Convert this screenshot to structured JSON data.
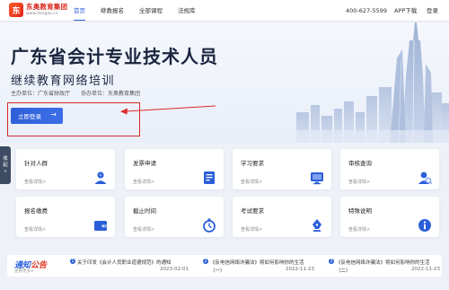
{
  "header": {
    "logo_badge": "东",
    "logo_name": "东奥教育集团",
    "logo_url_text": "www.dongao.cn",
    "nav": [
      {
        "label": "首页",
        "active": true
      },
      {
        "label": "继教报名",
        "active": false
      },
      {
        "label": "全部课程",
        "active": false
      },
      {
        "label": "法规库",
        "active": false
      }
    ],
    "hotline": "400-627-5599",
    "app_download": "APP下载",
    "login": "登录"
  },
  "hero": {
    "title": "广东省会计专业技术人员",
    "subtitle": "继续教育网络培训",
    "sponsor": "主办单位：广东省财政厅",
    "co_sponsor": "协办单位：东奥教育集团",
    "start_button": "立即登录",
    "start_arrow": "→"
  },
  "side_tab": {
    "chars": [
      "收",
      "起",
      "»"
    ]
  },
  "cards": [
    {
      "title": "针对人群",
      "link": "查看详情>",
      "icon": "user-icon"
    },
    {
      "title": "发票申请",
      "link": "查看详情>",
      "icon": "invoice-icon"
    },
    {
      "title": "学习要求",
      "link": "查看详情>",
      "icon": "monitor-icon"
    },
    {
      "title": "审核查询",
      "link": "查看详情>",
      "icon": "search-person-icon"
    },
    {
      "title": "报名缴费",
      "link": "查看详情>",
      "icon": "wallet-icon"
    },
    {
      "title": "截止时间",
      "link": "查看详情>",
      "icon": "stopwatch-icon"
    },
    {
      "title": "考试要求",
      "link": "查看详情>",
      "icon": "pen-nib-icon"
    },
    {
      "title": "特殊说明",
      "link": "查看详情>",
      "icon": "info-icon"
    }
  ],
  "notice": {
    "brand_a": "通知",
    "brand_b": "公告",
    "more": "查看更多>",
    "items": [
      {
        "badge": "1",
        "title": "关于印发《会计人员职业道德规范》的通知",
        "title2": "",
        "date": "2023-02-01"
      },
      {
        "badge": "2",
        "title": "《反电信网络诈骗法》将如何影响你的生活",
        "title2": "（一）",
        "date": "2022-11-23"
      },
      {
        "badge": "3",
        "title": "《反电信网络诈骗法》将如何影响你的生活",
        "title2": "（二）",
        "date": "2022-11-23"
      }
    ]
  },
  "colors": {
    "accent": "#2b5fd9",
    "annotation": "#d92b2b",
    "title": "#1b2540"
  }
}
